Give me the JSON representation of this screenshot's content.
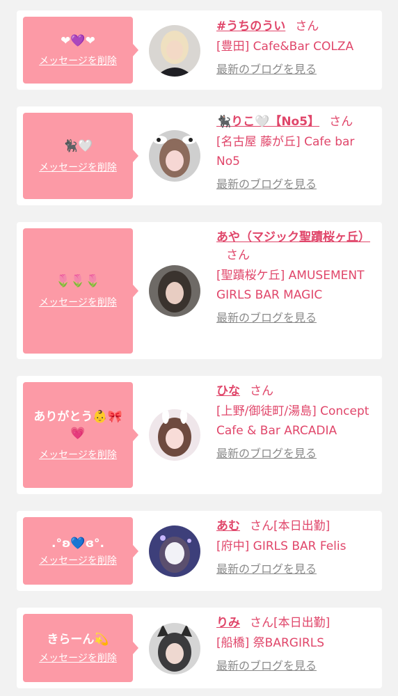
{
  "colors": {
    "background": "#f2f2f2",
    "card": "#ffffff",
    "bubble": "#fc9aa6",
    "accent": "#e0466a",
    "link_gray": "#8a8a8a"
  },
  "labels": {
    "delete": "メッセージを削除",
    "san": "さん",
    "blog": "最新のブログを見る"
  },
  "items": [
    {
      "message": "❤︎💜❤︎",
      "name": "#うちのうい",
      "attendance": "",
      "shop": "[豊田] Cafe&Bar COLZA",
      "avatar_icon": "avatar-photo-blonde-girl"
    },
    {
      "message": "🐈‍⬛🤍",
      "name": "🐈‍⬛りこ🤍【No5】",
      "attendance": "",
      "shop": "[名古屋 藤が丘] Cafe bar No5",
      "avatar_icon": "avatar-photo-cow-ears-girl"
    },
    {
      "message": "🌷🌷🌷",
      "name": "あや（マジック聖蹟桜ヶ丘）",
      "attendance": "",
      "shop": "[聖蹟桜ケ丘] AMUSEMENT GIRLS BAR MAGIC",
      "avatar_icon": "avatar-photo-dark-hair-girl"
    },
    {
      "message": "ありがとう👶🎀💗",
      "name": "ひな",
      "attendance": "",
      "shop": "[上野/御徒町/湯島] Concept Cafe & Bar ARCADIA",
      "avatar_icon": "avatar-photo-bunny-girl"
    },
    {
      "message": ".°ʚ💙ɞ°.",
      "name": "あむ",
      "attendance": "[本日出勤]",
      "shop": "[府中] GIRLS BAR Felis",
      "avatar_icon": "avatar-photo-blurred-face"
    },
    {
      "message": "きらーん💫",
      "name": "りみ",
      "attendance": "[本日出勤]",
      "shop": "[船橋] 祭BARGIRLS",
      "avatar_icon": "avatar-photo-cat-ears-girl"
    }
  ]
}
